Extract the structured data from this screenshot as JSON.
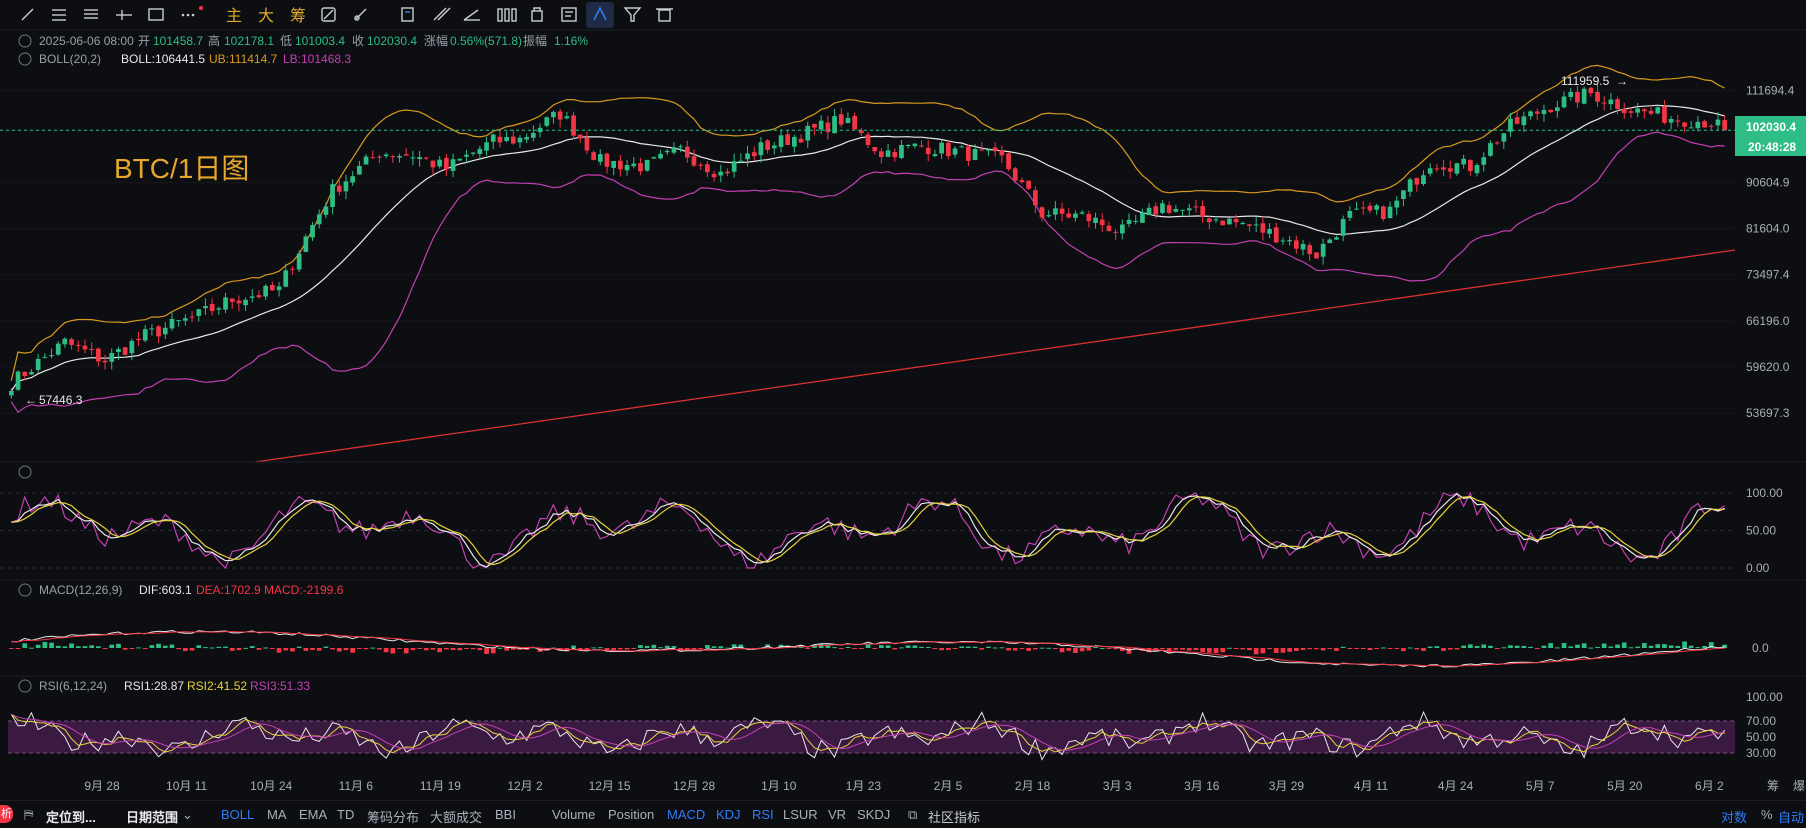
{
  "title": "BTC/1日图",
  "toolbar": {
    "main_label": "主",
    "big_label": "大",
    "chip_label": "筹",
    "icons": [
      "line-tool-icon",
      "hline-tool-icon",
      "multi-line-icon",
      "ray-icon",
      "rect-tool-icon",
      "more-icon",
      "copy-icon",
      "ruler-icon",
      "brush-icon",
      "compare-icon",
      "snapshot-icon",
      "edit-icon",
      "magnet-icon",
      "filter-icon",
      "trash-icon"
    ]
  },
  "ohlc": {
    "date": "2025-06-06 08:00",
    "open_label": "开",
    "open": "101458.7",
    "high_label": "高",
    "high": "102178.1",
    "low_label": "低",
    "low": "101003.4",
    "close_label": "收",
    "close": "102030.4",
    "chg_label": "涨幅",
    "chg": "0.56%(571.8)",
    "amp_label": "振幅",
    "amp": "1.16%"
  },
  "boll": {
    "label": "BOLL(20,2)",
    "mid": "BOLL:106441.5",
    "ub": "UB:111414.7",
    "lb": "LB:101468.3"
  },
  "macd": {
    "label": "MACD(12,26,9)",
    "dif": "DIF:603.1",
    "dea": "DEA:1702.9",
    "macd": "MACD:-2199.6"
  },
  "rsi": {
    "label": "RSI(6,12,24)",
    "rsi1": "RSI1:28.87",
    "rsi2": "RSI2:41.52",
    "rsi3": "RSI3:51.33"
  },
  "price_marks": {
    "high_mark": "111959.5",
    "low_mark": "57446.3",
    "last_price": "102030.4",
    "countdown": "20:48:28"
  },
  "colors": {
    "up": "#2ebd85",
    "down": "#f23645",
    "ub": "#d89a1d",
    "mid": "#e8e8e8",
    "lb": "#c43fb4",
    "trend": "#d8322e",
    "kdj_k": "#e8e8e8",
    "kdj_d": "#e6d23a",
    "kdj_j": "#c43fb4",
    "accent": "#2f7cf6"
  },
  "chart_data": {
    "type": "candlestick",
    "y_axis_ticks": [
      "111694.4",
      "102030.4",
      "90604.9",
      "81604.0",
      "73497.4",
      "66196.0",
      "59620.0",
      "53697.3"
    ],
    "x_axis_ticks": [
      "9月 28",
      "10月 11",
      "10月 24",
      "11月 6",
      "11月 19",
      "12月 2",
      "12月 15",
      "12月 28",
      "1月 10",
      "1月 23",
      "2月 5",
      "2月 18",
      "3月 3",
      "3月 16",
      "3月 29",
      "4月 11",
      "4月 24",
      "5月 7",
      "5月 20",
      "6月 2"
    ],
    "close_path": [
      [
        0,
        57446
      ],
      [
        8,
        63000
      ],
      [
        14,
        60500
      ],
      [
        20,
        64000
      ],
      [
        28,
        67000
      ],
      [
        33,
        69500
      ],
      [
        40,
        71000
      ],
      [
        48,
        89000
      ],
      [
        55,
        97000
      ],
      [
        60,
        96500
      ],
      [
        65,
        93500
      ],
      [
        72,
        99500
      ],
      [
        76,
        100000
      ],
      [
        82,
        106000
      ],
      [
        88,
        95000
      ],
      [
        95,
        94000
      ],
      [
        100,
        97500
      ],
      [
        106,
        92500
      ],
      [
        112,
        98000
      ],
      [
        118,
        101000
      ],
      [
        124,
        104500
      ],
      [
        130,
        97000
      ],
      [
        136,
        98500
      ],
      [
        142,
        97000
      ],
      [
        148,
        95500
      ],
      [
        154,
        84500
      ],
      [
        160,
        84000
      ],
      [
        166,
        81000
      ],
      [
        172,
        86000
      ],
      [
        178,
        84000
      ],
      [
        184,
        82500
      ],
      [
        190,
        80000
      ],
      [
        195,
        77000
      ],
      [
        200,
        84000
      ],
      [
        206,
        85000
      ],
      [
        212,
        95000
      ],
      [
        218,
        94000
      ],
      [
        224,
        103000
      ],
      [
        230,
        108000
      ],
      [
        236,
        111000
      ],
      [
        242,
        107000
      ],
      [
        248,
        105000
      ],
      [
        254,
        104000
      ],
      [
        256,
        102030
      ]
    ],
    "oscillator_ticks": [
      "100.00",
      "50.00",
      "0.00"
    ],
    "macd_ticks": [
      "0.0"
    ],
    "rsi_ticks": [
      "100.00",
      "70.00",
      "50.00",
      "30.00"
    ]
  },
  "bottom_bar": {
    "left_items": [
      "定位到...",
      "日期范围"
    ],
    "indicators": [
      "BOLL",
      "MA",
      "EMA",
      "TD",
      "筹码分布",
      "大额成交",
      "BBI"
    ],
    "sub_indicators": [
      "Volume",
      "Position",
      "MACD",
      "KDJ",
      "RSI",
      "LSUR",
      "VR",
      "SKDJ"
    ],
    "community": "社区指标",
    "right_items": [
      "对数",
      "%",
      "自动"
    ],
    "corner_labels": [
      "筹",
      "爆"
    ]
  }
}
